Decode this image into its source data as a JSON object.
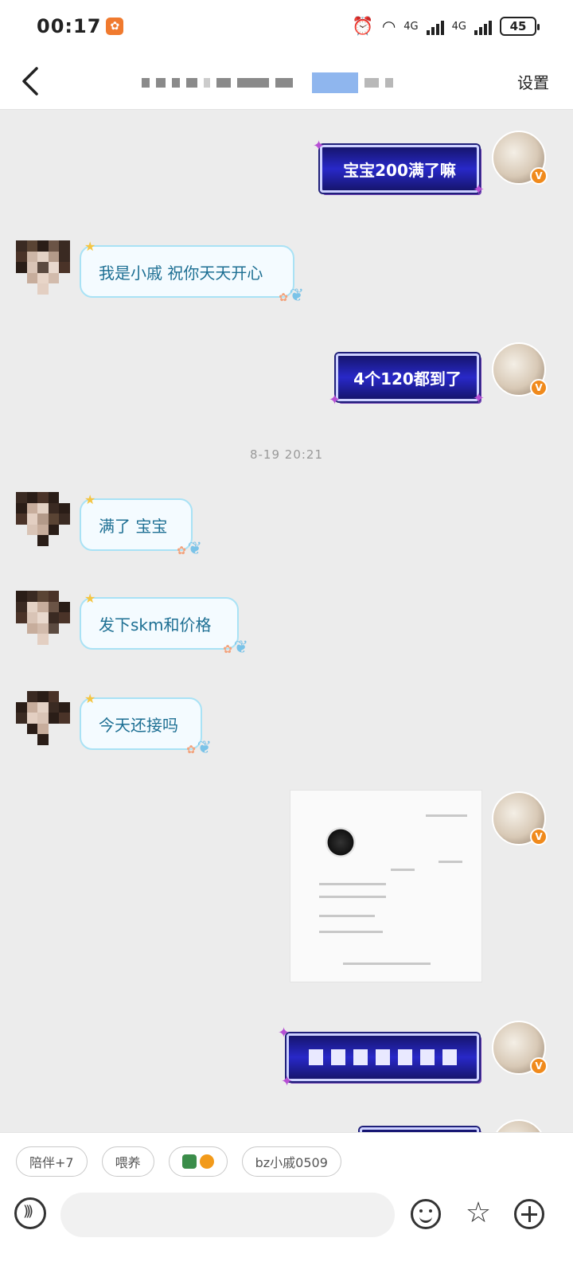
{
  "status": {
    "time": "00:17",
    "battery": "45",
    "network_1": "4G",
    "network_2": "4G"
  },
  "header": {
    "settings_label": "设置"
  },
  "messages": {
    "m1": "宝宝200满了嘛",
    "m2": "我是小戚  祝你天天开心",
    "m3": "4个120都到了",
    "timestamp": "8-19 20:21",
    "m4": "满了  宝宝",
    "m5": "发下skm和价格",
    "m6": "今天还接吗"
  },
  "quick_actions": {
    "chip1": "陪伴+7",
    "chip2": "喂养",
    "chip4": "bz小戚0509"
  },
  "icons": {
    "back": "back-arrow-icon",
    "voice": "voice-icon",
    "emoji": "emoji-icon",
    "sticker": "star-sticker-icon",
    "plus": "plus-icon",
    "vip_badge": "v-badge-icon"
  },
  "colors": {
    "vip_bubble": "#2828c8",
    "reply_bubble_border": "#a9e2f5",
    "reply_text": "#1d6f93",
    "badge": "#f08a1c"
  }
}
